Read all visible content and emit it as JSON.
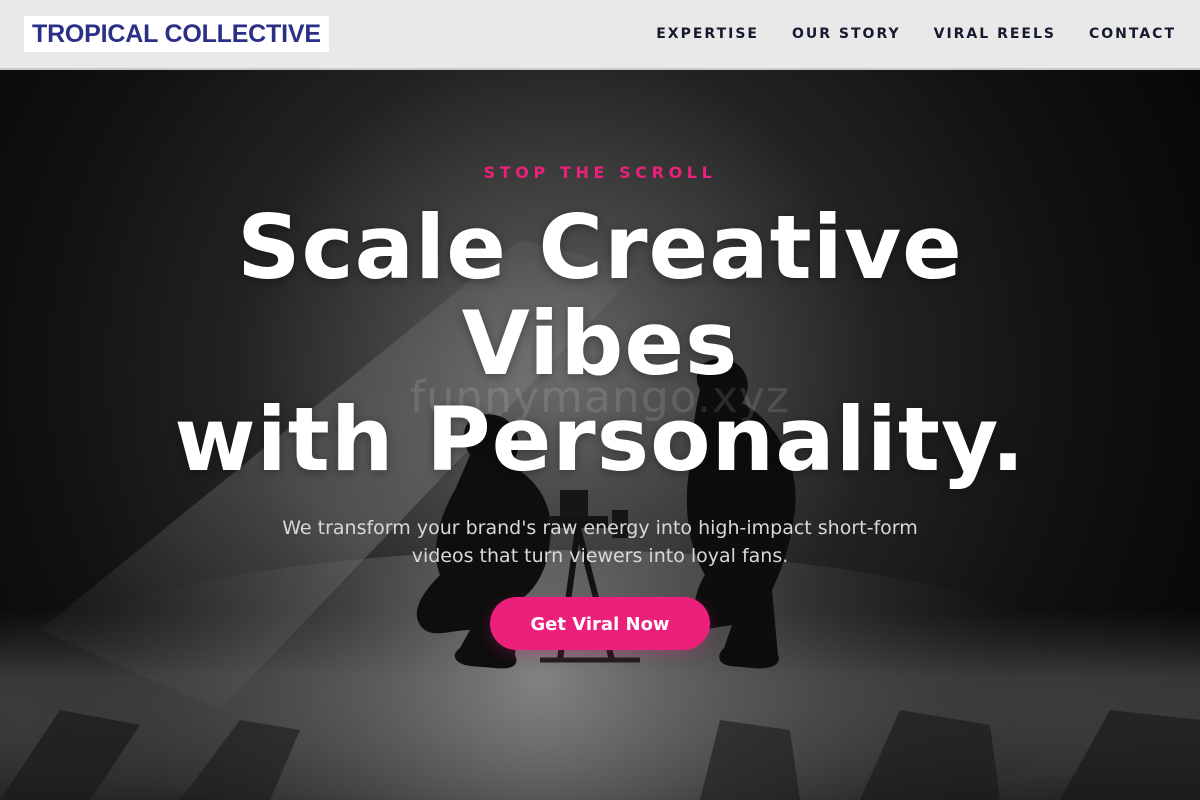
{
  "nav": {
    "logo": "TROPICAL COLLECTIVE",
    "links": [
      {
        "label": "EXPERTISE"
      },
      {
        "label": "OUR STORY"
      },
      {
        "label": "VIRAL REELS"
      },
      {
        "label": "CONTACT"
      }
    ]
  },
  "hero": {
    "eyebrow": "STOP THE SCROLL",
    "headline_lines": [
      "Scale Creative",
      "Vibes",
      "with Personality."
    ],
    "subtext_lines": [
      "We transform your brand's raw energy into high-impact short-form",
      "videos that turn viewers into loyal fans."
    ],
    "cta_label": "Get Viral Now",
    "watermark": "funnymango.xyz"
  },
  "colors": {
    "nav_bg": "#e9e9ea",
    "logo_text": "#2b2f86",
    "nav_text": "#161a2e",
    "accent_pink": "#ec1f7a",
    "hero_bg": "#0a0a0a",
    "headline": "#ffffff",
    "subtext": "#d8d8da"
  },
  "icons": []
}
